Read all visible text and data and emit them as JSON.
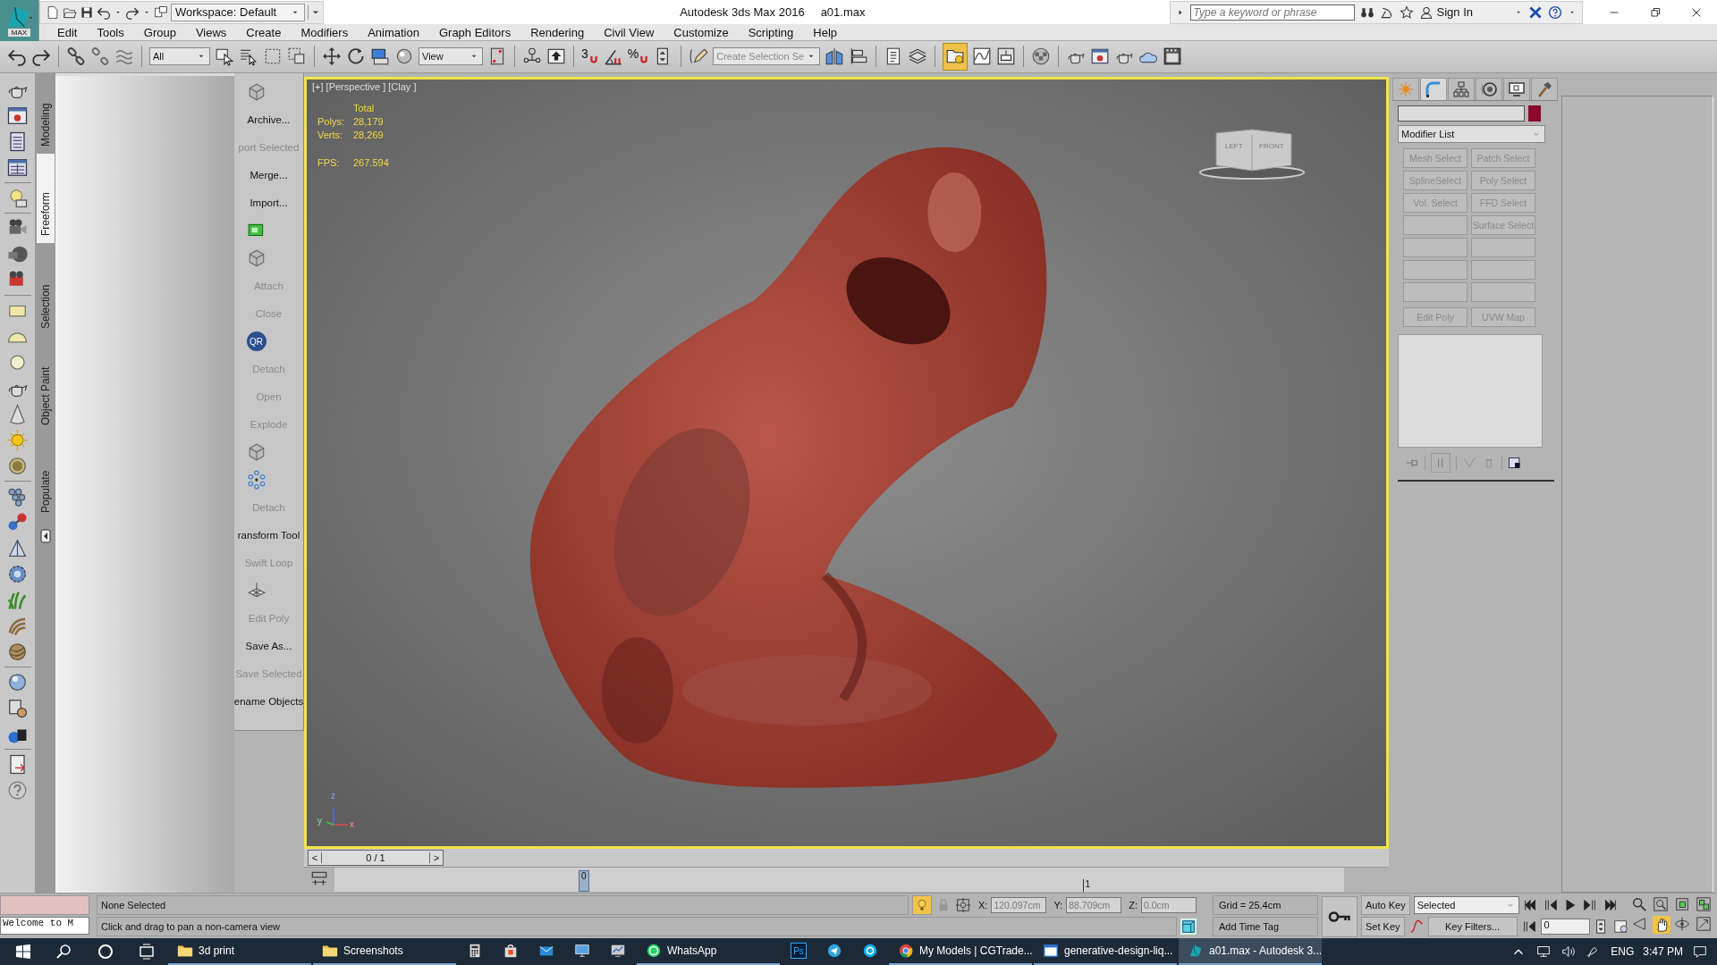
{
  "title_bar": {
    "app_button": "MAX",
    "workspace": "Workspace: Default",
    "title": "Autodesk 3ds Max 2016",
    "file": "a01.max",
    "search_placeholder": "Type a keyword or phrase",
    "sign_in": "Sign In"
  },
  "menu": [
    "Edit",
    "Tools",
    "Group",
    "Views",
    "Create",
    "Modifiers",
    "Animation",
    "Graph Editors",
    "Rendering",
    "Civil View",
    "Customize",
    "Scripting",
    "Help"
  ],
  "main_toolbar": {
    "selection_filter": "All",
    "reference_coord": "View",
    "dimension_snap": "3",
    "percent_snap": "%",
    "named_selection": "Create Selection Se",
    "explorer_toggle_on": true
  },
  "ribbon_tabs": [
    {
      "label": "Modeling",
      "selected": false
    },
    {
      "label": "Freeform",
      "selected": true
    },
    {
      "label": "Selection",
      "selected": false
    },
    {
      "label": "Object Paint",
      "selected": false
    },
    {
      "label": "Populate",
      "selected": false
    }
  ],
  "graphite_panel": [
    {
      "kind": "cube"
    },
    {
      "kind": "command",
      "label": "Archive...",
      "disabled": false
    },
    {
      "kind": "command",
      "label": "port Selected",
      "disabled": true
    },
    {
      "kind": "command",
      "label": "Merge...",
      "disabled": false
    },
    {
      "kind": "command",
      "label": "Import...",
      "disabled": false
    },
    {
      "kind": "monitor"
    },
    {
      "kind": "cube"
    },
    {
      "kind": "command",
      "label": "Attach",
      "disabled": true
    },
    {
      "kind": "command",
      "label": "Close",
      "disabled": true
    },
    {
      "kind": "badge",
      "label": "QR"
    },
    {
      "kind": "command",
      "label": "Detach",
      "disabled": true
    },
    {
      "kind": "command",
      "label": "Open",
      "disabled": true
    },
    {
      "kind": "command",
      "label": "Explode",
      "disabled": true
    },
    {
      "kind": "cube"
    },
    {
      "kind": "dots"
    },
    {
      "kind": "command",
      "label": "Detach",
      "disabled": true
    },
    {
      "kind": "command",
      "label": "ransform Tool",
      "disabled": false
    },
    {
      "kind": "command",
      "label": "Swift Loop",
      "disabled": true
    },
    {
      "kind": "plane"
    },
    {
      "kind": "command",
      "label": "Edit Poly",
      "disabled": true
    },
    {
      "kind": "command",
      "label": "Save As...",
      "disabled": false
    },
    {
      "kind": "command",
      "label": "Save Selected",
      "disabled": true
    },
    {
      "kind": "command",
      "label": "ename Objects",
      "disabled": false
    }
  ],
  "viewport": {
    "active": true,
    "label": "[+] [Perspective ] [Clay ]",
    "stats_heading": "Total",
    "stats": [
      {
        "name": "Polys:",
        "value": "28,179"
      },
      {
        "name": "Verts:",
        "value": "28,269"
      }
    ],
    "fps_name": "FPS:",
    "fps": "267.594",
    "viewcube": [
      "LEFT",
      "FRONT"
    ],
    "axes": [
      "z",
      "y",
      "x"
    ]
  },
  "command_panel": {
    "tabs": [
      {
        "selected": false
      },
      {
        "selected": true
      },
      {
        "selected": false
      },
      {
        "selected": false
      },
      {
        "selected": false
      },
      {
        "selected": false
      }
    ],
    "object_swatch": {
      "color": "#8b0a2a"
    },
    "modifier_list": "Modifier List",
    "modifier_buttons": [
      {
        "kind": "preset",
        "label": "Mesh Select",
        "disabled": true
      },
      {
        "kind": "preset",
        "label": "Patch Select",
        "disabled": true
      },
      {
        "kind": "preset",
        "label": "SplineSelect",
        "disabled": true
      },
      {
        "kind": "preset",
        "label": "Poly Select",
        "disabled": true
      },
      {
        "kind": "preset",
        "label": "Vol. Select",
        "disabled": true
      },
      {
        "kind": "preset",
        "label": "FFD Select",
        "disabled": true
      },
      {
        "kind": "empty"
      },
      {
        "kind": "preset",
        "label": "Surface Select",
        "disabled": true
      },
      {
        "kind": "empty"
      },
      {
        "kind": "empty"
      },
      {
        "kind": "empty"
      },
      {
        "kind": "empty"
      },
      {
        "kind": "empty"
      },
      {
        "kind": "empty"
      },
      {
        "kind": "preset",
        "label": "Edit Poly",
        "disabled": true
      },
      {
        "kind": "preset",
        "label": "UVW Map",
        "disabled": true
      }
    ]
  },
  "time_slider": {
    "prev": "<",
    "frame": "0 / 1",
    "next": ">",
    "level": 0
  },
  "track_bar": {
    "ticks": [
      "0",
      "1"
    ]
  },
  "status": {
    "listener_output": "Welcome to M",
    "selection": "None Selected",
    "prompt": "Click and drag to pan a non-camera view",
    "isolate_on": true,
    "x_label": "X:",
    "x": "120.097cm",
    "y_label": "Y:",
    "y": "88.709cm",
    "z_label": "Z:",
    "z": "0.0cm",
    "grid": "Grid = 25.4cm",
    "time_tag": "Add Time Tag",
    "auto_key": "Auto Key",
    "set_key": "Set Key",
    "key_mode": "Selected",
    "key_filters": "Key Filters...",
    "frame": "0",
    "pan_on": true
  },
  "taskbar": {
    "apps": [
      {
        "kind": "folder",
        "label": "3d print",
        "running": true,
        "active": false
      },
      {
        "kind": "folder",
        "label": "Screenshots",
        "running": true,
        "active": false
      },
      {
        "kind": "calculator",
        "running": false,
        "active": false
      },
      {
        "kind": "store",
        "running": false,
        "active": false
      },
      {
        "kind": "mail",
        "running": false,
        "active": false
      },
      {
        "kind": "monitor",
        "running": false,
        "active": false
      },
      {
        "kind": "chart",
        "running": false,
        "active": false
      },
      {
        "kind": "whatsapp",
        "label": "WhatsApp",
        "running": true,
        "active": false
      },
      {
        "kind": "photoshop",
        "glyph": "Ps",
        "running": false,
        "active": false
      },
      {
        "kind": "telegram",
        "running": false,
        "active": false
      },
      {
        "kind": "skype",
        "running": false,
        "active": false
      },
      {
        "kind": "chrome",
        "label": "My Models | CGTrade...",
        "running": true,
        "active": false
      },
      {
        "kind": "window",
        "label": "generative-design-liq...",
        "running": true,
        "active": false
      },
      {
        "kind": "max",
        "label": "a01.max - Autodesk 3...",
        "running": true,
        "active": true
      }
    ],
    "language": "ENG",
    "time": "3:47 PM"
  }
}
